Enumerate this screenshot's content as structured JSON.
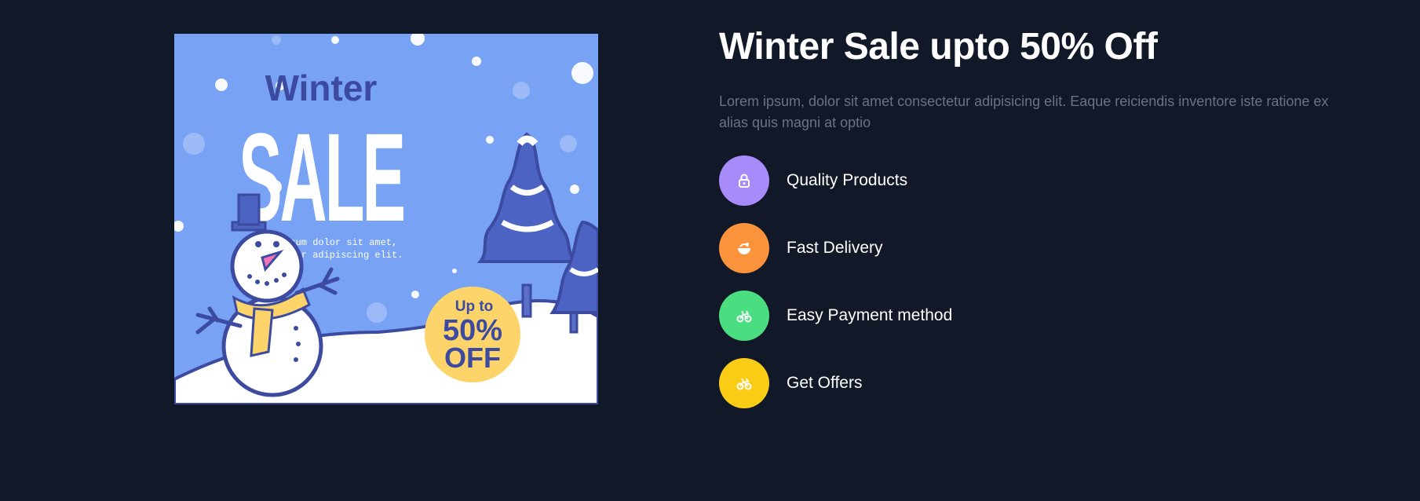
{
  "banner": {
    "script_word": "Winter",
    "sale_word": "SALE",
    "tagline_line1": "Lorem ipsum dolor sit amet,",
    "tagline_line2": "consectetuer adipiscing elit.",
    "badge_line1": "Up to",
    "badge_line2": "50%",
    "badge_line3": "OFF"
  },
  "section": {
    "headline": "Winter Sale upto 50% Off",
    "description": "Lorem ipsum, dolor sit amet consectetur adipisicing elit. Eaque reiciendis inventore iste ratione ex alias quis magni at optio"
  },
  "features": [
    {
      "label": "Quality Products",
      "icon": "lock-icon",
      "color": "#a78bfa"
    },
    {
      "label": "Fast Delivery",
      "icon": "food-bowl-icon",
      "color": "#fb923c"
    },
    {
      "label": "Easy Payment method",
      "icon": "bike-icon",
      "color": "#4ade80"
    },
    {
      "label": "Get Offers",
      "icon": "bike-icon",
      "color": "#facc15"
    }
  ],
  "colors": {
    "page_background": "#111827",
    "banner_sky": "#78a2f4",
    "banner_ink": "#3c4aa0",
    "badge": "#fcd46a",
    "description_text": "#6b7280"
  }
}
